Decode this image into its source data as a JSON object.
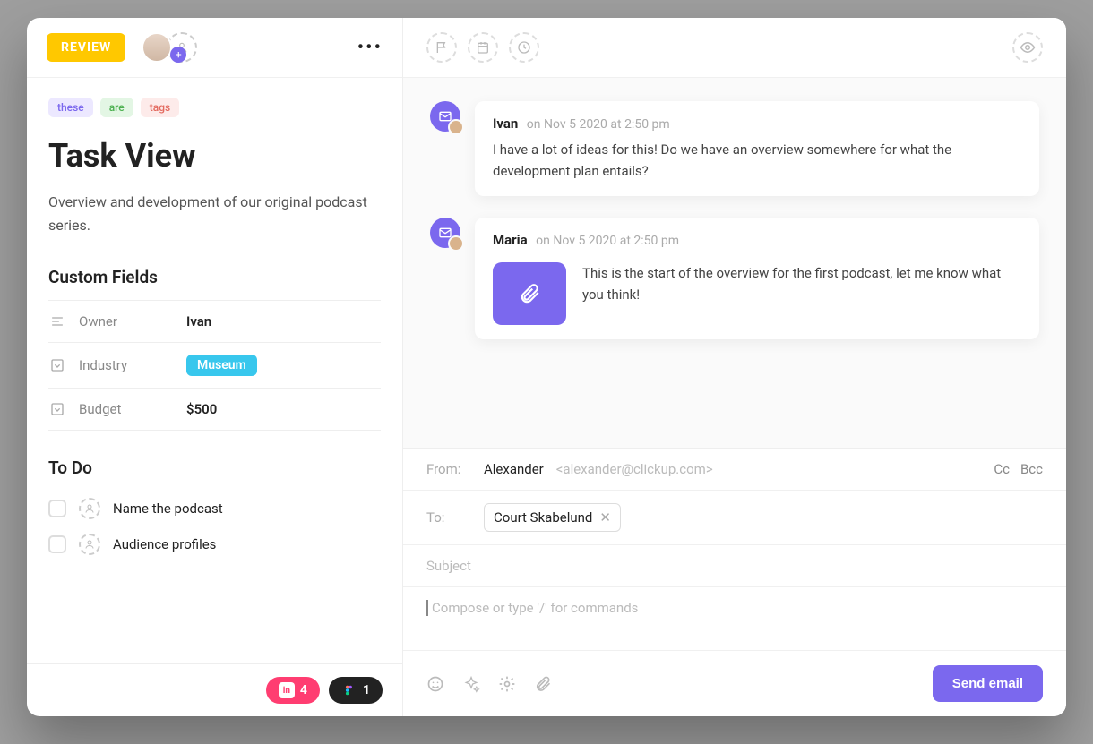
{
  "header": {
    "status": "REVIEW"
  },
  "tags": [
    "these",
    "are",
    "tags"
  ],
  "title": "Task View",
  "description": "Overview and development of our original podcast series.",
  "custom_fields_heading": "Custom Fields",
  "custom_fields": {
    "owner_label": "Owner",
    "owner_value": "Ivan",
    "industry_label": "Industry",
    "industry_value": "Museum",
    "budget_label": "Budget",
    "budget_value": "$500"
  },
  "todo_heading": "To Do",
  "todos": [
    "Name the podcast",
    "Audience profiles"
  ],
  "footer_chips": {
    "invision_count": "4",
    "figma_count": "1"
  },
  "thread": [
    {
      "author": "Ivan",
      "meta": "on Nov 5 2020 at 2:50 pm",
      "text": "I have a lot of ideas for this! Do we have an overview somewhere for what the development plan entails?"
    },
    {
      "author": "Maria",
      "meta": "on Nov 5 2020 at 2:50 pm",
      "text": "This is the start of the overview for the first podcast, let me know what you think!"
    }
  ],
  "composer": {
    "from_label": "From:",
    "from_name": "Alexander",
    "from_email": "<alexander@clickup.com>",
    "cc": "Cc",
    "bcc": "Bcc",
    "to_label": "To:",
    "to_chip": "Court Skabelund",
    "subject_placeholder": "Subject",
    "body_placeholder": "Compose or type '/' for commands",
    "send_label": "Send email"
  }
}
